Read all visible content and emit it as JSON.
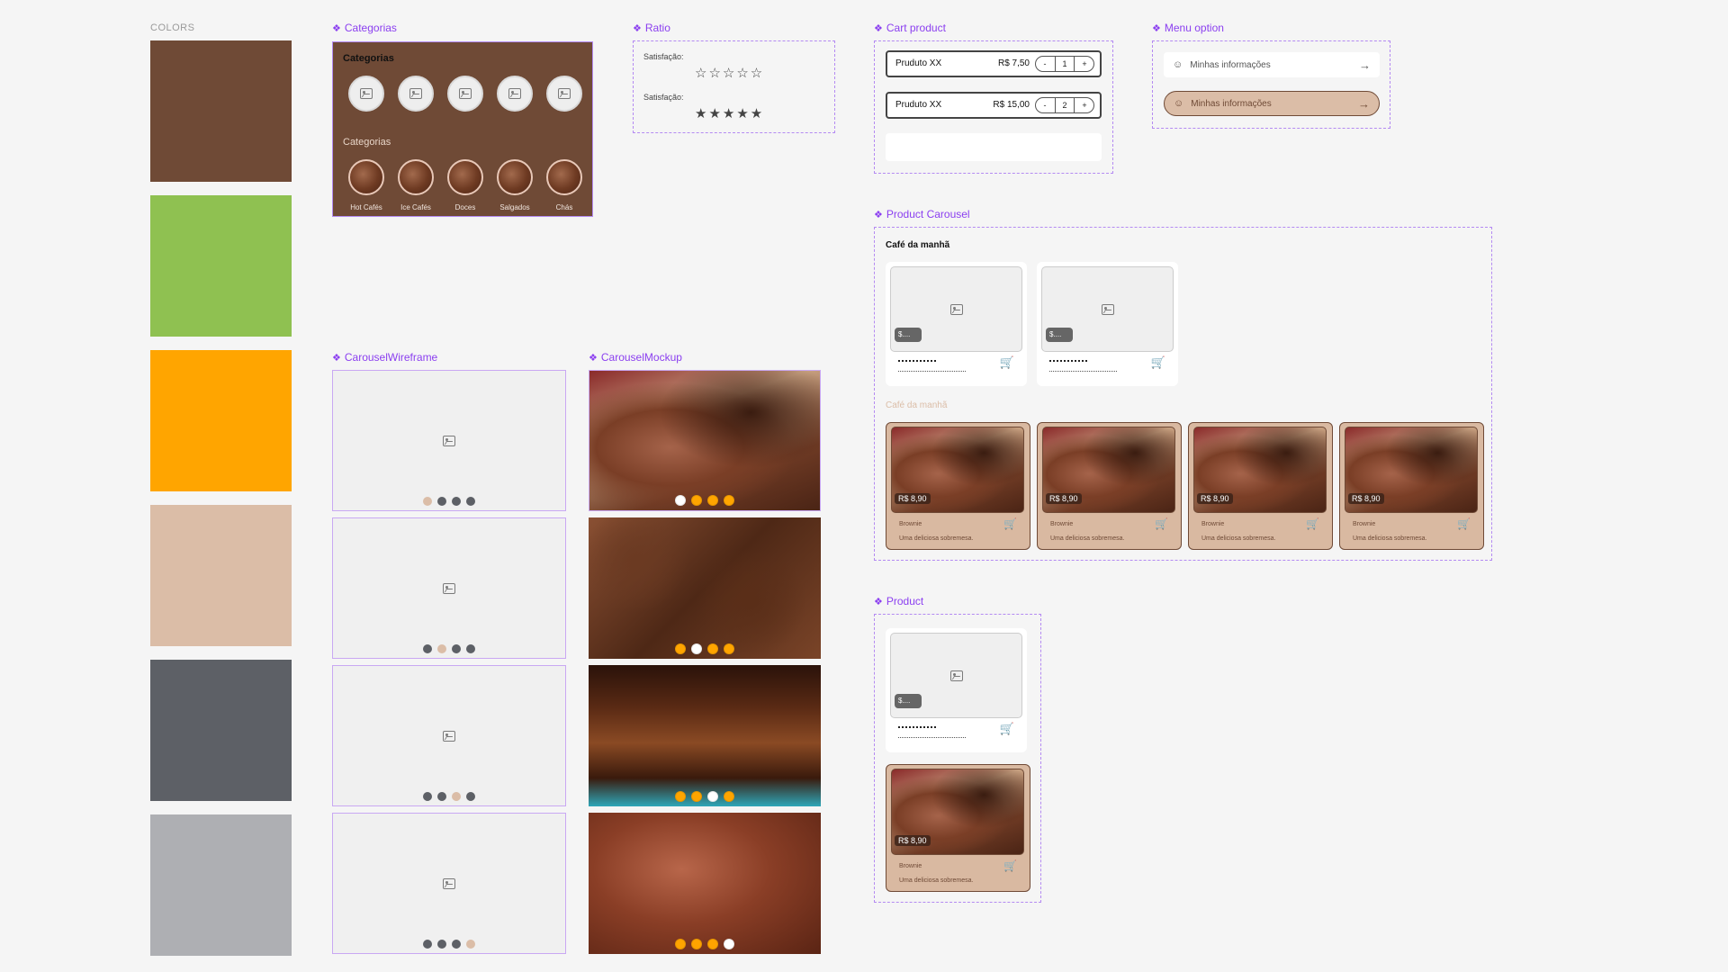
{
  "colors_label": "COLORS",
  "swatches": [
    "#6f4a36",
    "#8fc151",
    "#ffa500",
    "#dbbda7",
    "#5d6066",
    "#aeafb3"
  ],
  "sections": {
    "categorias": "Categorias",
    "ratio": "Ratio",
    "cart": "Cart product",
    "menu": "Menu option",
    "carousel_wf": "CarouselWireframe",
    "carousel_mk": "CarouselMockup",
    "product_carousel": "Product Carousel",
    "product": "Product"
  },
  "categorias": {
    "title_top": "Categorias",
    "title_bottom": "Categorias",
    "items": [
      "Hot Cafés",
      "Ice Cafés",
      "Doces",
      "Salgados",
      "Chás"
    ]
  },
  "ratio": {
    "label1": "Satisfação:",
    "stars1": "☆☆☆☆☆",
    "label2": "Satisfação:",
    "stars2": "★★★★★"
  },
  "cart": {
    "rows": [
      {
        "name": "Pruduto XX",
        "price": "R$ 7,50",
        "minus": "-",
        "qty": "1",
        "plus": "+"
      },
      {
        "name": "Pruduto XX",
        "price": "R$ 15,00",
        "minus": "-",
        "qty": "2",
        "plus": "+"
      }
    ]
  },
  "menu": {
    "opt1": "Minhas informações",
    "opt2": "Minhas informações"
  },
  "product_carousel": {
    "title1": "Café da manhã",
    "title2": "Café da manhã",
    "wf_price": "$....",
    "mk_price": "R$ 8,90",
    "mk_name": "Brownie",
    "mk_desc": "Uma deliciosa sobremesa."
  },
  "icons": {
    "cart": "cart-icon",
    "image": "image-placeholder-icon",
    "user": "user-icon",
    "arrow": "arrow-right-icon",
    "diamond": "component-icon"
  },
  "dot_colors": {
    "active_wf": "#dbbda7",
    "inactive_wf": "#5d6066",
    "active_mk": "#ffffff",
    "inactive_mk": "#ffa500"
  }
}
